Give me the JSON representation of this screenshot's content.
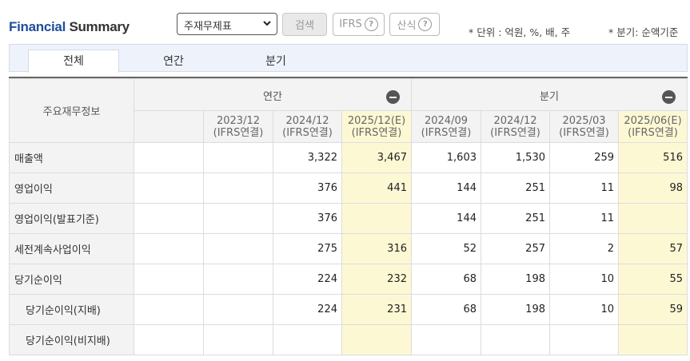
{
  "header": {
    "title_part1": "Financial",
    "title_part2": "Summary",
    "statement_select": "주재무제표",
    "search_label": "검색",
    "ifrs_label": "IFRS",
    "formula_label": "산식",
    "help_glyph": "?",
    "unit_note": "* 단위 : 억원, %, 배, 주",
    "quarter_note": "* 분기: 순액기준"
  },
  "tabs": [
    {
      "label": "전체",
      "active": true
    },
    {
      "label": "연간",
      "active": false
    },
    {
      "label": "분기",
      "active": false
    }
  ],
  "table": {
    "row_header_title": "주요재무정보",
    "group_annual": "연간",
    "group_quarter": "분기",
    "columns": [
      {
        "period": "2023/12",
        "basis": "(IFRS연결)",
        "estimate": false
      },
      {
        "period": "2024/12",
        "basis": "(IFRS연결)",
        "estimate": false
      },
      {
        "period": "2025/12(E)",
        "basis": "(IFRS연결)",
        "estimate": true
      },
      {
        "period": "2024/09",
        "basis": "(IFRS연결)",
        "estimate": false
      },
      {
        "period": "2024/12",
        "basis": "(IFRS연결)",
        "estimate": false
      },
      {
        "period": "2025/03",
        "basis": "(IFRS연결)",
        "estimate": false
      },
      {
        "period": "2025/06(E)",
        "basis": "(IFRS연결)",
        "estimate": true
      }
    ],
    "rows": [
      {
        "label": "매출액",
        "sub": false,
        "values": [
          "",
          "3,322",
          "3,467",
          "1,603",
          "1,530",
          "259",
          "516"
        ]
      },
      {
        "label": "영업이익",
        "sub": false,
        "values": [
          "",
          "376",
          "441",
          "144",
          "251",
          "11",
          "98"
        ]
      },
      {
        "label": "영업이익(발표기준)",
        "sub": false,
        "values": [
          "",
          "376",
          "",
          "144",
          "251",
          "11",
          ""
        ]
      },
      {
        "label": "세전계속사업이익",
        "sub": false,
        "values": [
          "",
          "275",
          "316",
          "52",
          "257",
          "2",
          "57"
        ]
      },
      {
        "label": "당기순이익",
        "sub": false,
        "values": [
          "",
          "224",
          "232",
          "68",
          "198",
          "10",
          "55"
        ]
      },
      {
        "label": "당기순이익(지배)",
        "sub": true,
        "values": [
          "",
          "224",
          "231",
          "68",
          "198",
          "10",
          "59"
        ]
      },
      {
        "label": "당기순이익(비지배)",
        "sub": true,
        "values": [
          "",
          "",
          "",
          "",
          "",
          "",
          ""
        ]
      }
    ]
  },
  "colors": {
    "brand_blue": "#1f4e9c",
    "estimate_bg": "#fdf8d4",
    "tab_bg": "#eef2fb"
  }
}
